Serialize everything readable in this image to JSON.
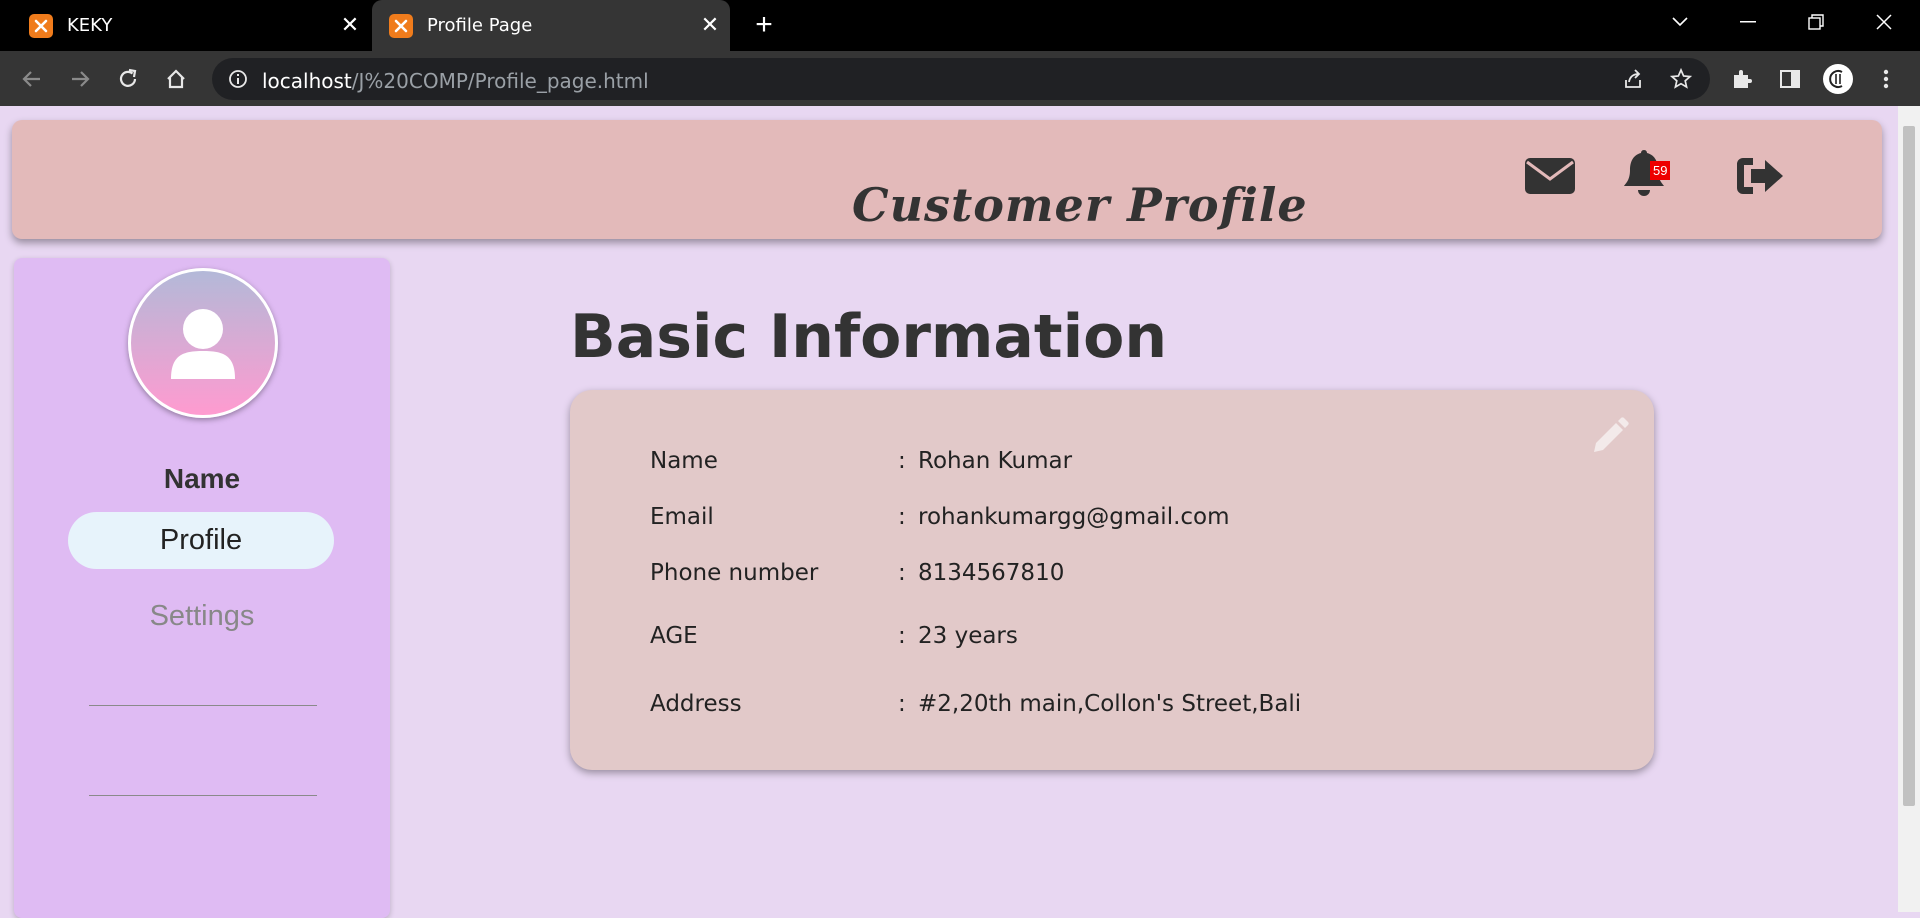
{
  "browser": {
    "tabs": [
      {
        "title": "KEKY",
        "active": false
      },
      {
        "title": "Profile Page",
        "active": true
      }
    ],
    "url_host": "localhost",
    "url_path": "/J%20COMP/Profile_page.html"
  },
  "header": {
    "title": "Customer Profile",
    "notification_count": "59",
    "icons": [
      "envelope-icon",
      "bell-icon",
      "logout-icon"
    ]
  },
  "sidebar": {
    "name": "Name",
    "items": [
      {
        "label": "Profile",
        "active": true
      },
      {
        "label": "Settings",
        "active": false
      }
    ]
  },
  "main": {
    "heading": "Basic Information",
    "fields": [
      {
        "label": "Name",
        "value": "Rohan Kumar"
      },
      {
        "label": "Email",
        "value": "rohankumargg@gmail.com"
      },
      {
        "label": "Phone number",
        "value": "8134567810"
      },
      {
        "label": "AGE",
        "value": "23 years"
      },
      {
        "label": "Address",
        "value": "#2,20th main,Collon's Street,Bali"
      }
    ],
    "separator": ":"
  },
  "colors": {
    "page_bg": "#e8d7f2",
    "header_bg": "#e3baba",
    "sidebar_bg": "#dfbbf3",
    "card_bg": "#e2c9c9",
    "badge": "#ee0000"
  }
}
